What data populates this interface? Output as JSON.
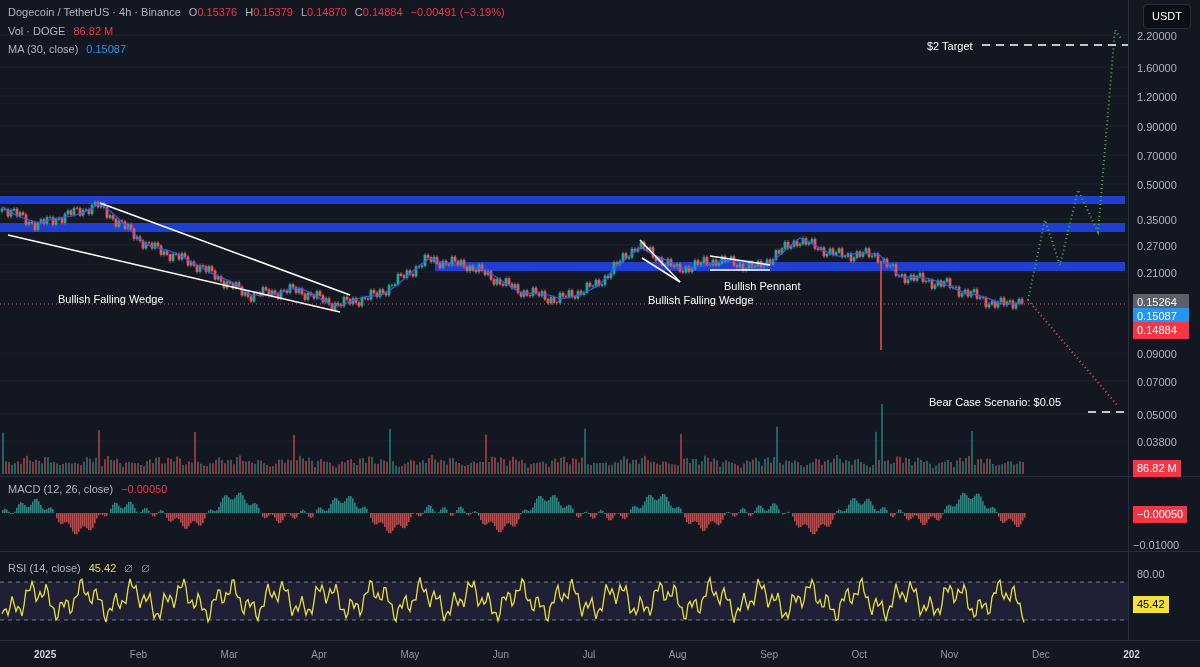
{
  "header": {
    "symbol": "Dogecoin / TetherUS · 4h · Binance",
    "ohlc": [
      {
        "key": "O",
        "value": "0.15376"
      },
      {
        "key": "H",
        "value": "0.15379"
      },
      {
        "key": "L",
        "value": "0.14870"
      },
      {
        "key": "C",
        "value": "0.14884"
      }
    ],
    "change": "−0.00491 (−3.19%)"
  },
  "volume_legend": {
    "label": "Vol · DOGE",
    "value": "86.82 M"
  },
  "ma_legend": {
    "label": "MA (30, close)",
    "value": "0.15087"
  },
  "currency": "USDT",
  "price_axis": [
    "2.20000",
    "1.60000",
    "1.20000",
    "0.90000",
    "0.70000",
    "0.50000",
    "0.35000",
    "0.27000",
    "0.21000",
    "0.09000",
    "0.07000",
    "0.05000",
    "0.03800"
  ],
  "price_labels": [
    {
      "value": "0.15264",
      "color": "#5d606b"
    },
    {
      "value": "0.15087",
      "color": "#2196f3"
    },
    {
      "value": "0.14884",
      "color": "#f23645"
    }
  ],
  "annotations": [
    "$2 Target",
    "Bear Case Scenario: $0.05",
    "Bullish Falling Wedge",
    "Bullish Falling Wedge",
    "Bullish Pennant"
  ],
  "volume_label": "86.82 M",
  "macd": {
    "label": "MACD (12, 26, close)",
    "value": "−0.00050",
    "axis": "−0.01000",
    "price_label": "−0.00050"
  },
  "rsi": {
    "label": "RSI (14, close)",
    "value": "45.42",
    "axis": "80.00",
    "price_label": "45.42"
  },
  "time_axis": [
    {
      "label": "2025",
      "kind": "year"
    },
    {
      "label": "Feb",
      "kind": "month"
    },
    {
      "label": "Mar",
      "kind": "month"
    },
    {
      "label": "Apr",
      "kind": "month"
    },
    {
      "label": "May",
      "kind": "month"
    },
    {
      "label": "Jun",
      "kind": "month"
    },
    {
      "label": "Jul",
      "kind": "month"
    },
    {
      "label": "Aug",
      "kind": "month"
    },
    {
      "label": "Sep",
      "kind": "month"
    },
    {
      "label": "Oct",
      "kind": "month"
    },
    {
      "label": "Nov",
      "kind": "month"
    },
    {
      "label": "Dec",
      "kind": "month"
    },
    {
      "label": "202",
      "kind": "year"
    }
  ]
}
